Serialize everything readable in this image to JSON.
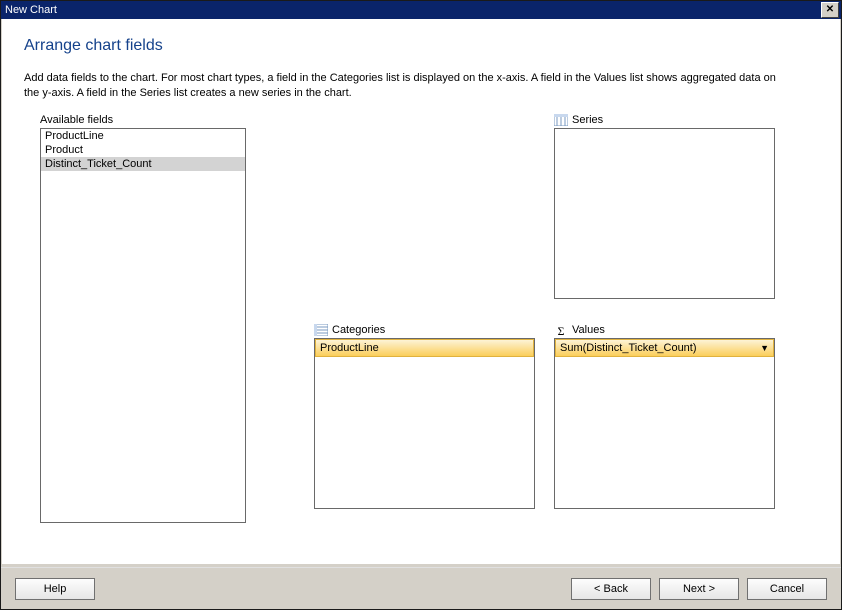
{
  "window": {
    "title": "New Chart"
  },
  "page": {
    "heading": "Arrange chart fields",
    "description": "Add data fields to the chart. For most chart types, a field in the Categories list is displayed on the x-axis. A field in the Values list shows aggregated data on the y-axis. A field in the Series list creates a new series in the chart."
  },
  "zones": {
    "available": {
      "label": "Available fields",
      "items": [
        "ProductLine",
        "Product",
        "Distinct_Ticket_Count"
      ],
      "selected_index": 2
    },
    "series": {
      "label": "Series",
      "items": []
    },
    "categories": {
      "label": "Categories",
      "items": [
        "ProductLine"
      ]
    },
    "values": {
      "label": "Values",
      "items": [
        "Sum(Distinct_Ticket_Count)"
      ]
    }
  },
  "buttons": {
    "help": "Help",
    "back": "< Back",
    "next": "Next >",
    "cancel": "Cancel"
  }
}
